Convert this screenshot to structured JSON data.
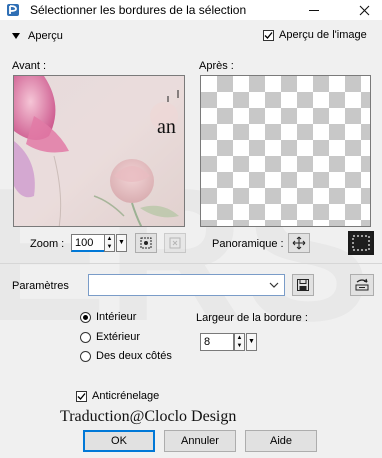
{
  "window": {
    "title": "Sélectionner les bordures de la sélection",
    "minimize_icon": "minimize-icon",
    "close_icon": "close-icon"
  },
  "header": {
    "collapse_label": "Aperçu",
    "image_preview_label": "Aperçu de l'image",
    "image_preview_checked": true
  },
  "preview": {
    "before_label": "Avant :",
    "after_label": "Après :",
    "before_image_text": "an"
  },
  "zoom": {
    "label": "Zoom :",
    "value": "100",
    "pan_label": "Panoramique :"
  },
  "presets": {
    "label": "Paramètres",
    "value": ""
  },
  "options": {
    "radio_inside": "Intérieur",
    "radio_outside": "Extérieur",
    "radio_both": "Des deux côtés",
    "selected": "inside",
    "border_width_label": "Largeur de la bordure :",
    "border_width_value": "8",
    "antialias_label": "Anticrénelage",
    "antialias_checked": true
  },
  "watermark_text": "Traduction@Cloclo Design",
  "buttons": {
    "ok": "OK",
    "cancel": "Annuler",
    "help": "Aide"
  }
}
